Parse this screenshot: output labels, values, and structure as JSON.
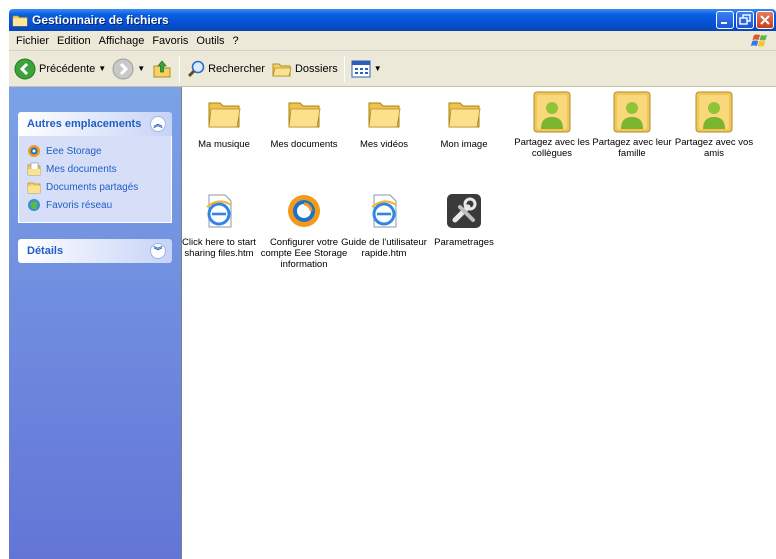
{
  "window": {
    "title": "Gestionnaire de fichiers"
  },
  "menu": [
    "Fichier",
    "Edition",
    "Affichage",
    "Favoris",
    "Outils",
    "?"
  ],
  "toolbar": {
    "back_label": "Précédente",
    "search_label": "Rechercher",
    "folders_label": "Dossiers"
  },
  "sidebar": {
    "other_places": {
      "title": "Autres emplacements",
      "items": [
        {
          "label": "Eee Storage",
          "icon": "eee-storage-icon"
        },
        {
          "label": "Mes documents",
          "icon": "documents-icon"
        },
        {
          "label": "Documents partagés",
          "icon": "shared-folder-icon"
        },
        {
          "label": "Favoris réseau",
          "icon": "network-icon"
        }
      ]
    },
    "details": {
      "title": "Détails"
    }
  },
  "files": [
    {
      "label": "Ma musique",
      "icon": "folder-icon"
    },
    {
      "label": "Mes documents",
      "icon": "folder-icon"
    },
    {
      "label": "Mes vidéos",
      "icon": "folder-icon"
    },
    {
      "label": "Mon image",
      "icon": "folder-icon"
    },
    {
      "label": "Partagez avec les collègues",
      "icon": "shared-users-icon"
    },
    {
      "label": "Partagez avec leur famille",
      "icon": "shared-users-icon"
    },
    {
      "label": "Partagez avec vos amis",
      "icon": "shared-users-icon"
    },
    {
      "label": "Click here to start sharing files.htm",
      "icon": "ie-document-icon"
    },
    {
      "label": "Configurer votre compte Eee Storage information",
      "icon": "eee-storage-icon"
    },
    {
      "label": "Guide de l'utilisateur rapide.htm",
      "icon": "ie-document-icon"
    },
    {
      "label": "Parametrages",
      "icon": "settings-tools-icon"
    }
  ],
  "colors": {
    "titlebar": "#0553d6",
    "sidebar_gradient_top": "#7ba2e7",
    "sidebar_gradient_bottom": "#6375d6",
    "link": "#215dc6"
  }
}
